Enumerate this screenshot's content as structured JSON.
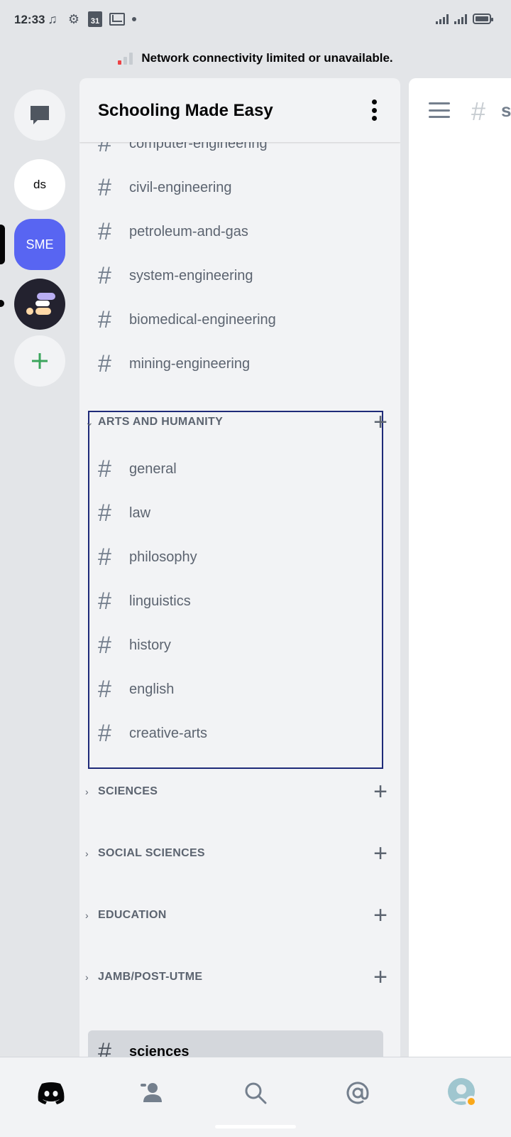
{
  "status_bar": {
    "time": "12:33",
    "calendar_day": "31",
    "icons": [
      "music-note-icon",
      "gear-icon",
      "calendar-icon",
      "gmail-icon",
      "dot-icon"
    ],
    "right_icons": [
      "signal-icon",
      "signal-icon",
      "battery-icon"
    ]
  },
  "network_banner": {
    "text": "Network connectivity limited or unavailable.",
    "color": "#ed4245"
  },
  "servers": {
    "ds_label": "ds",
    "sme_label": "SME",
    "accent": "#5865f2",
    "add_color": "#3ba55c"
  },
  "panel": {
    "title": "Schooling Made Easy"
  },
  "channels_top": [
    {
      "name": "computer-engineering"
    },
    {
      "name": "civil-engineering"
    },
    {
      "name": "petroleum-and-gas"
    },
    {
      "name": "system-engineering"
    },
    {
      "name": "biomedical-engineering"
    },
    {
      "name": "mining-engineering"
    }
  ],
  "arts": {
    "category": "ARTS AND HUMANITY",
    "channels": [
      {
        "name": "general"
      },
      {
        "name": "law"
      },
      {
        "name": "philosophy"
      },
      {
        "name": "linguistics"
      },
      {
        "name": "history"
      },
      {
        "name": "english"
      },
      {
        "name": "creative-arts"
      }
    ]
  },
  "collapsed_categories": [
    {
      "name": "SCIENCES"
    },
    {
      "name": "SOCIAL SCIENCES"
    },
    {
      "name": "EDUCATION"
    },
    {
      "name": "JAMB/POST-UTME"
    }
  ],
  "selected_channel": {
    "name": "sciences"
  },
  "glyphs": {
    "hash": "#",
    "plus": "+",
    "chevron_right": "›",
    "chevron_down": "⌄"
  },
  "peek": {
    "partial_text": "s"
  },
  "bottom_nav": [
    "discord-home-icon",
    "friends-icon",
    "search-icon",
    "mentions-icon",
    "profile-avatar"
  ]
}
